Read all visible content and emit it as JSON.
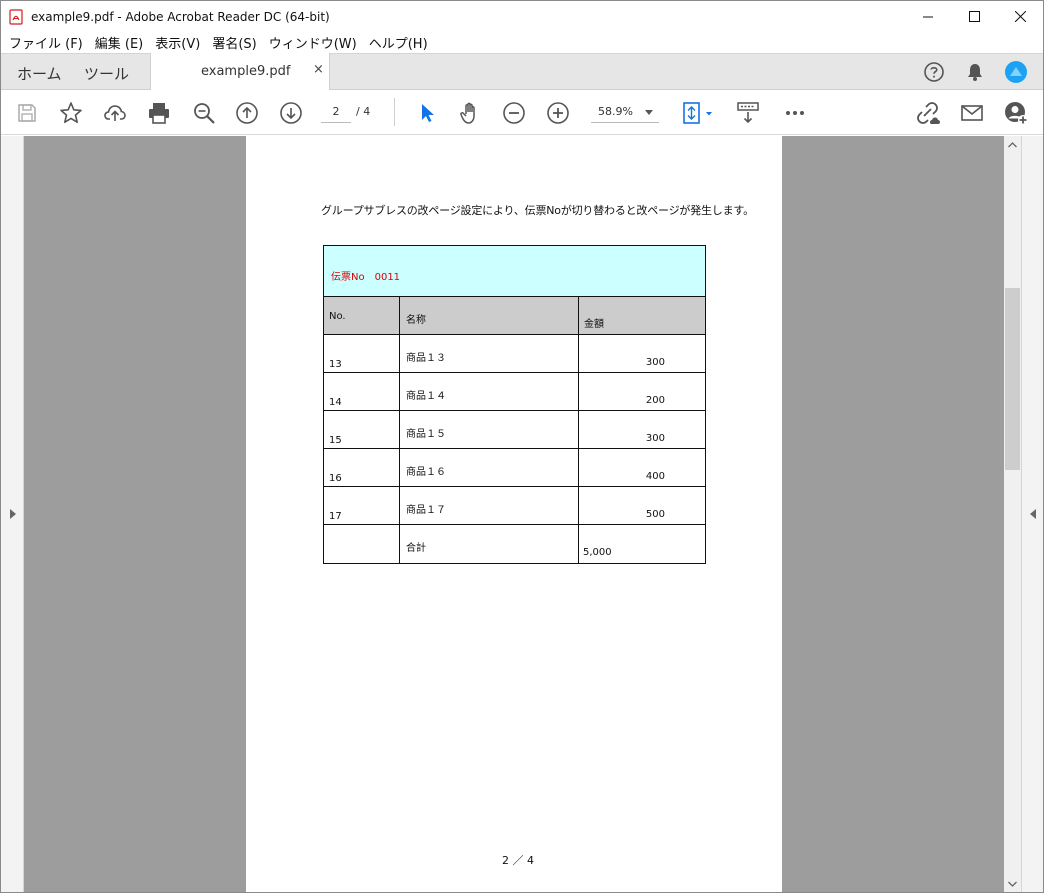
{
  "window": {
    "title": "example9.pdf - Adobe Acrobat Reader DC (64-bit)",
    "minimize": "—",
    "maximize": "☐",
    "close": "✕"
  },
  "menu": [
    "ファイル (F)",
    "編集 (E)",
    "表示(V)",
    "署名(S)",
    "ウィンドウ(W)",
    "ヘルプ(H)"
  ],
  "tabs": {
    "home": "ホーム",
    "tools": "ツール",
    "document": "example9.pdf",
    "close": "×"
  },
  "toolbar": {
    "page_current": "2",
    "page_total": "/ 4",
    "zoom": "58.9%"
  },
  "colors": {
    "accent": "#1473e6",
    "header_fill": "#ccffff",
    "header_text": "#e00000",
    "column_fill": "#cccccc"
  },
  "document": {
    "note": "グループサブレスの改ページ設定により、伝票Noが切り替わると改ページが発生します。",
    "slip_label": "伝票No　0011",
    "columns": [
      "No.",
      "名称",
      "金額"
    ],
    "rows": [
      {
        "no": "13",
        "name": "商品１３",
        "amount": "300"
      },
      {
        "no": "14",
        "name": "商品１４",
        "amount": "200"
      },
      {
        "no": "15",
        "name": "商品１５",
        "amount": "300"
      },
      {
        "no": "16",
        "name": "商品１６",
        "amount": "400"
      },
      {
        "no": "17",
        "name": "商品１７",
        "amount": "500"
      }
    ],
    "total_label": "合計",
    "total_amount": "5,000",
    "footer": "2 ／ 4"
  }
}
